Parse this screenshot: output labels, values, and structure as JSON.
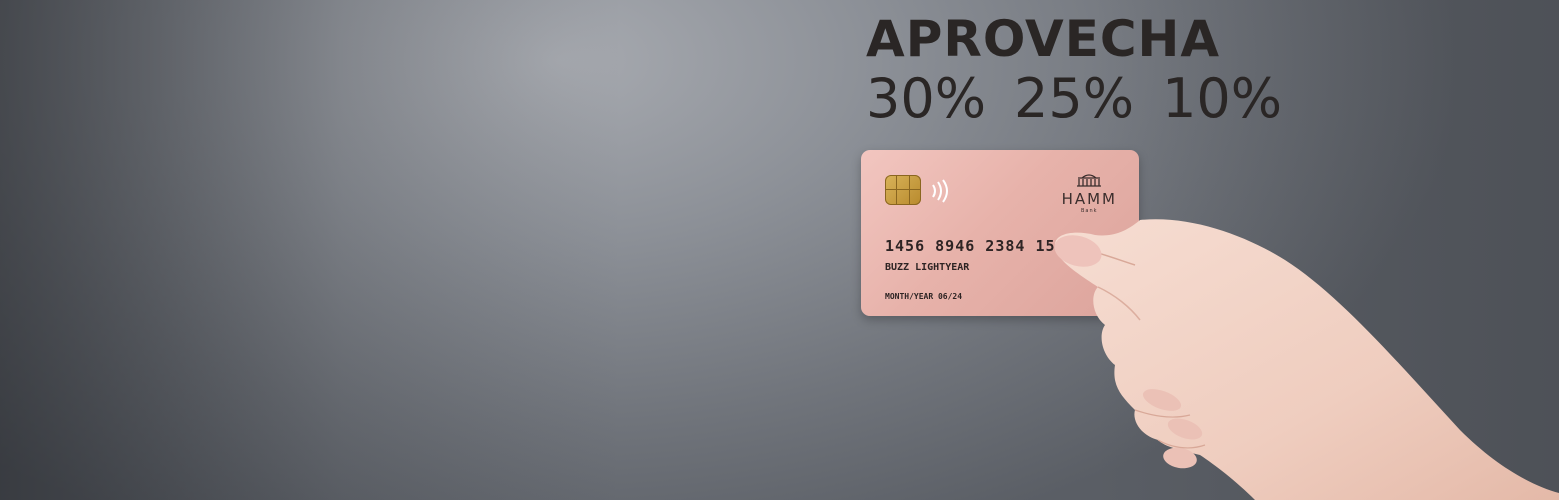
{
  "banner": {
    "headline": "APROVECHA",
    "discounts": [
      "30%",
      "25%",
      "10%"
    ]
  },
  "card": {
    "number": "1456 8946 2384 1569",
    "holder": "BUZZ LIGHTYEAR",
    "expiry": "MONTH/YEAR 06/24",
    "bank_name": "HAMM",
    "bank_sub": "Bank",
    "color": "#e7b2aa"
  },
  "colors": {
    "text": "#2a2625",
    "background": "#8c9097"
  }
}
